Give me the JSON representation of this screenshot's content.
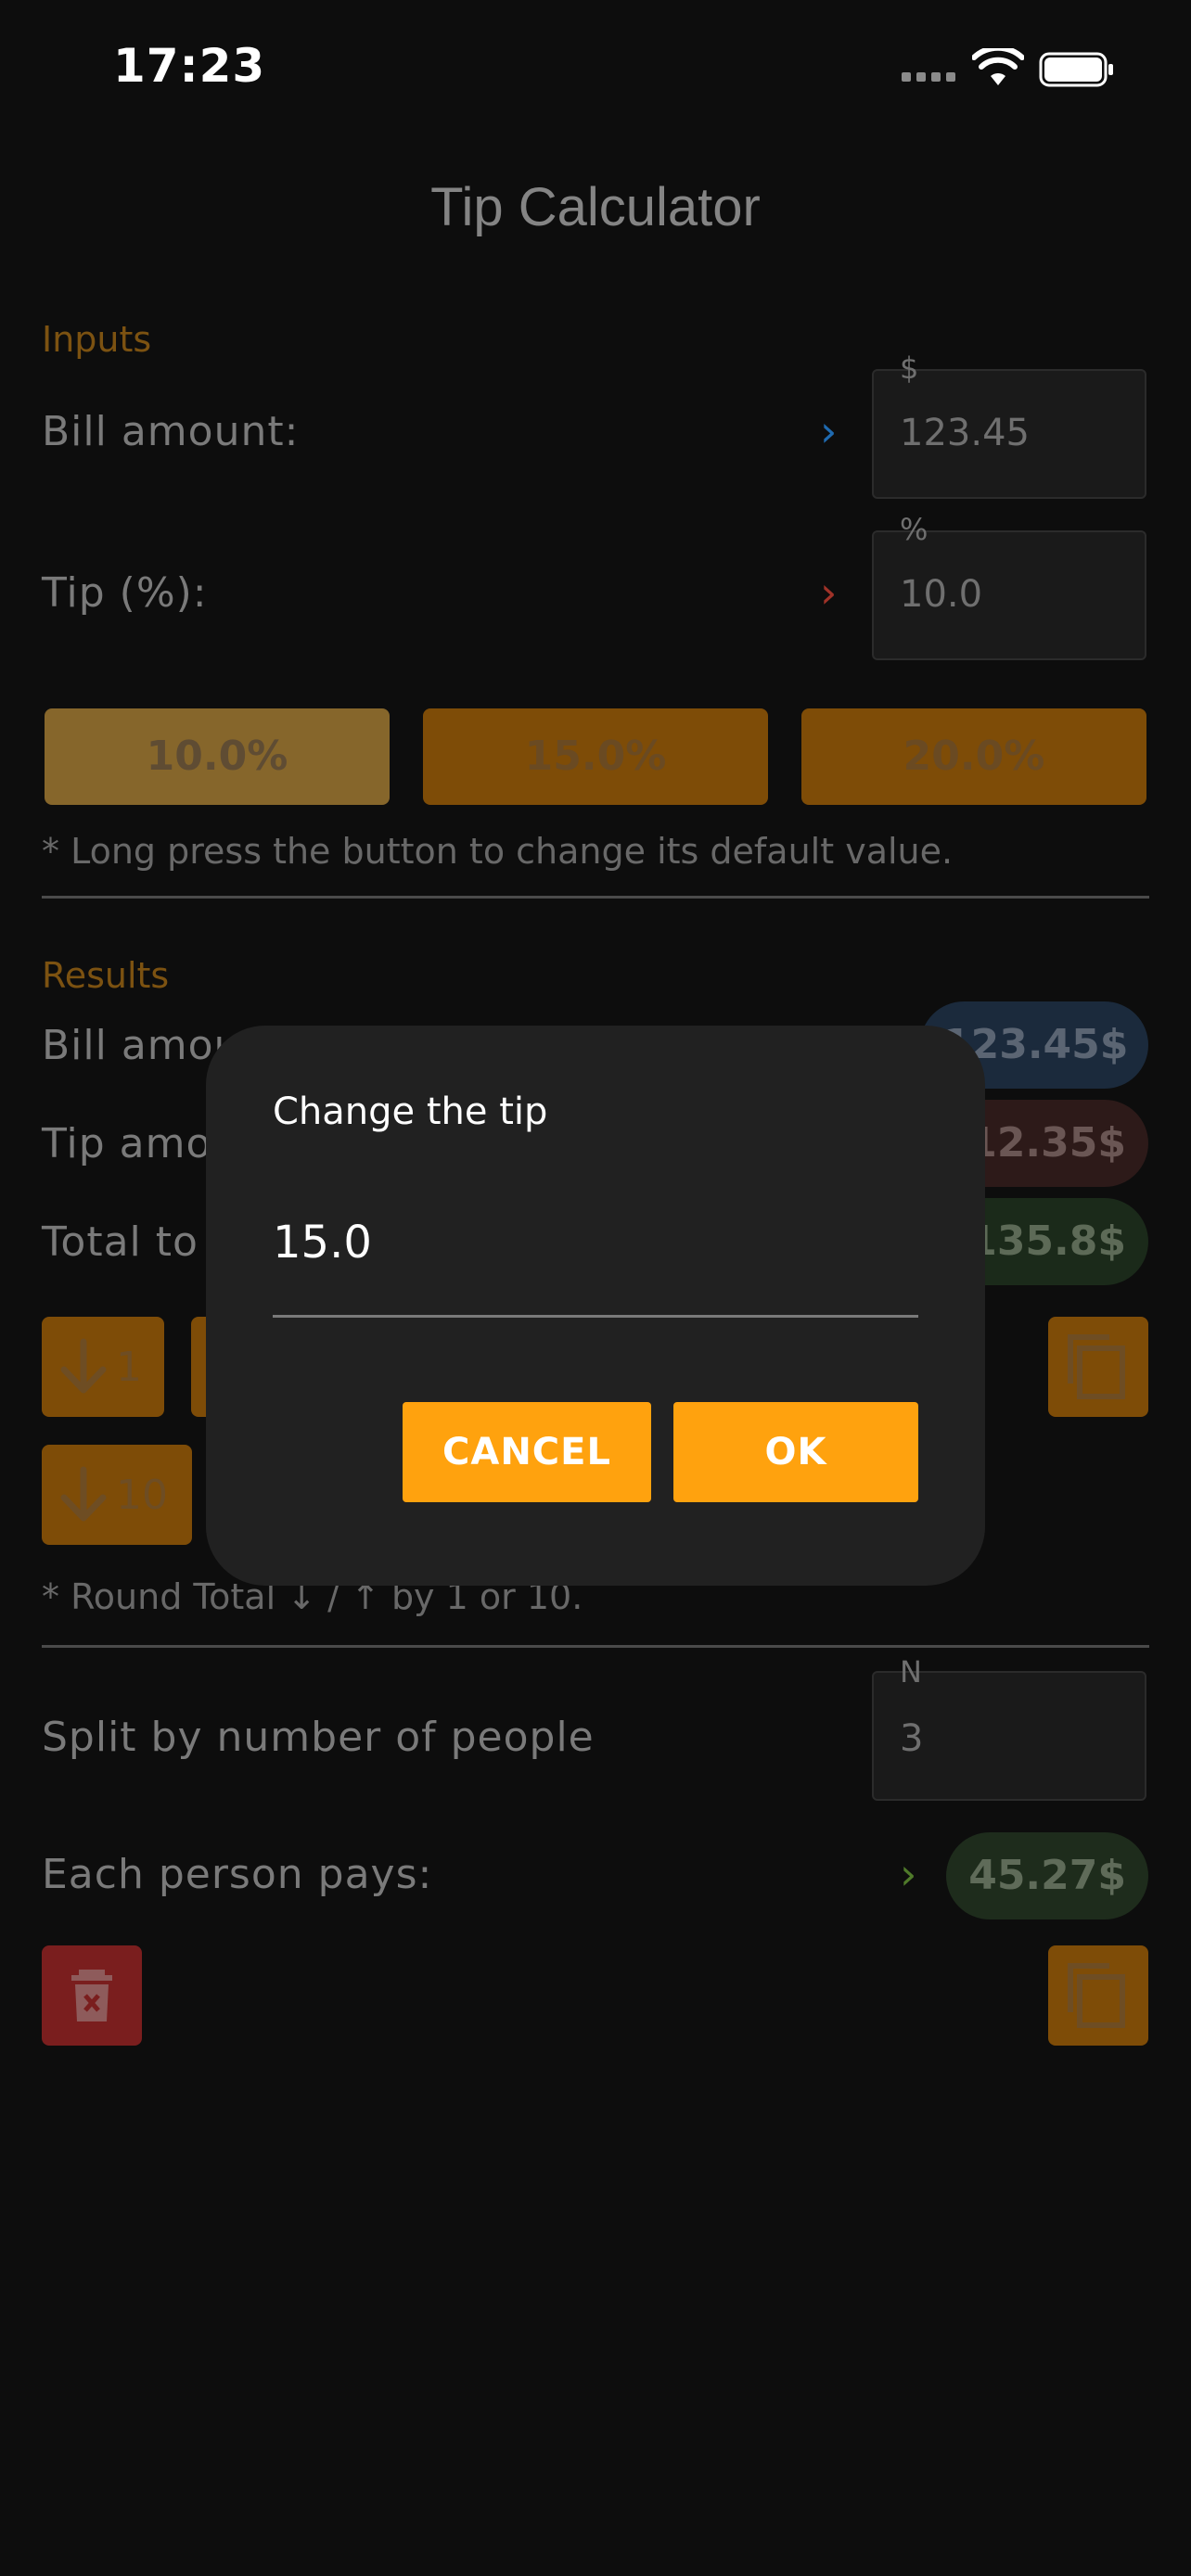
{
  "status_bar": {
    "time": "17:23"
  },
  "header": {
    "title": "Tip Calculator"
  },
  "inputs": {
    "section_label": "Inputs",
    "bill": {
      "label": "Bill amount:",
      "caption": "$",
      "value": "123.45"
    },
    "tip": {
      "label": "Tip (%):",
      "caption": "%",
      "value": "10.0"
    },
    "presets": [
      "10.0%",
      "15.0%",
      "20.0%"
    ],
    "hint": "* Long press the button to change its default value."
  },
  "results": {
    "section_label": "Results",
    "bill_amount_label": "Bill amou",
    "bill_amount_value": "123.45$",
    "tip_amount_label": "Tip amo",
    "tip_amount_value": "12.35$",
    "total_label": "Total to",
    "total_value": "135.8$",
    "round_down_1": "1",
    "round_down_10": "10",
    "round_hint": "* Round Total ↓ / ↑ by 1 or 10."
  },
  "split": {
    "label": "Split by number of people",
    "caption": "N",
    "value": "3",
    "each_label": "Each person pays:",
    "each_value": "45.27$"
  },
  "dialog": {
    "title": "Change the tip",
    "input_value": "15.0",
    "cancel_label": "CANCEL",
    "ok_label": "OK"
  },
  "colors": {
    "accent": "#ffa20e",
    "blue_chevron": "#1f6ab0",
    "red_chevron": "#a03228",
    "green_chevron": "#4f7a2a"
  }
}
